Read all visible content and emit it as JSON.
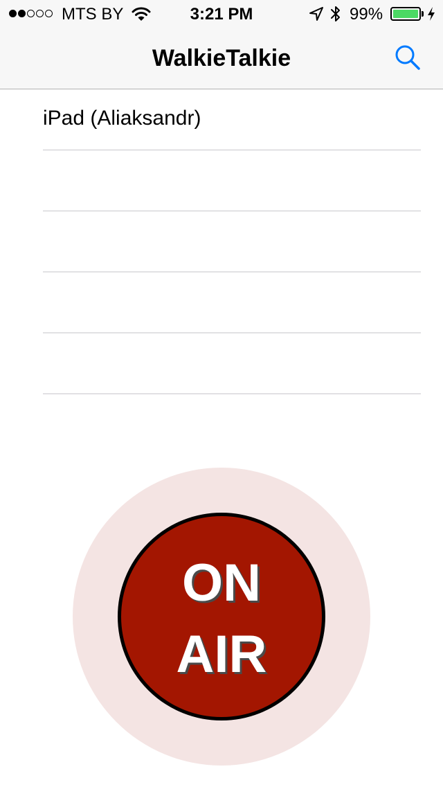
{
  "status_bar": {
    "signal_bars_filled": 2,
    "signal_bars_total": 5,
    "carrier": "MTS BY",
    "time": "3:21 PM",
    "battery_percent": "99%",
    "battery_level": 0.99,
    "icons": [
      "wifi-icon",
      "location-arrow-icon",
      "bluetooth-icon",
      "battery-icon",
      "charging-bolt-icon"
    ]
  },
  "nav": {
    "title": "WalkieTalkie",
    "search_icon": "search-icon",
    "accent_color": "#007aff"
  },
  "devices": {
    "items": [
      {
        "label": "iPad (Aliaksandr)"
      },
      {
        "label": ""
      },
      {
        "label": ""
      },
      {
        "label": ""
      },
      {
        "label": ""
      }
    ]
  },
  "air_button": {
    "line1": "ON",
    "line2": "AIR",
    "color": "#a31601",
    "halo_color": "#f4e4e3"
  }
}
